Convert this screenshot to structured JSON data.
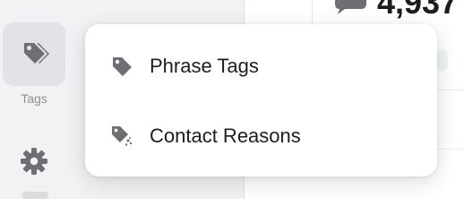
{
  "sidebar": {
    "tags_nav": {
      "label": "Tags",
      "icon": "tags-icon"
    },
    "settings_nav": {
      "icon": "gear-icon"
    }
  },
  "stat": {
    "value": "4,937",
    "icon": "chat-bubble-icon"
  },
  "popover": {
    "items": [
      {
        "label": "Phrase Tags",
        "icon": "tag-icon"
      },
      {
        "label": "Contact Reasons",
        "icon": "tag-sparkle-icon"
      }
    ]
  },
  "colors": {
    "sidebar_bg": "#f2f2f4",
    "active_nav_bg": "#e3e3e7",
    "icon_gray": "#6e6e74",
    "text": "#1d1d1f"
  }
}
